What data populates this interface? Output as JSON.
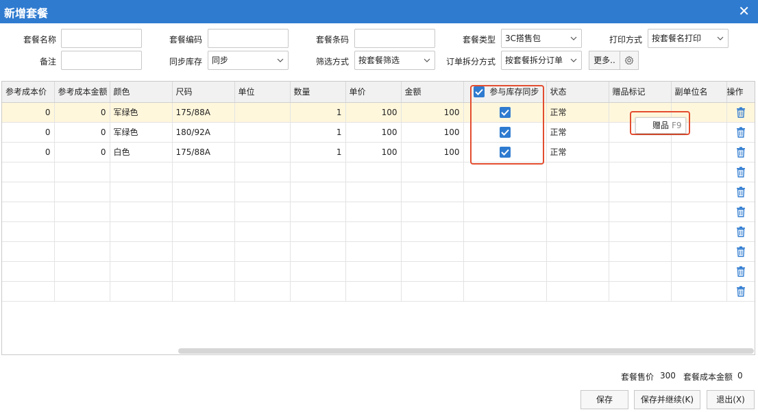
{
  "window": {
    "title": "新增套餐"
  },
  "form": {
    "name_label": "套餐名称",
    "code_label": "套餐编码",
    "barcode_label": "套餐条码",
    "type_label": "套餐类型",
    "type_value": "3C搭售包",
    "print_label": "打印方式",
    "print_value": "按套餐名打印",
    "remark_label": "备注",
    "sync_label": "同步库存",
    "sync_value": "同步",
    "filter_label": "筛选方式",
    "filter_value": "按套餐筛选",
    "split_label": "订单拆分方式",
    "split_value": "按套餐拆分订单",
    "more_label": "更多.."
  },
  "table": {
    "columns": [
      "参考成本价",
      "参考成本金额",
      "颜色",
      "尺码",
      "单位",
      "数量",
      "单价",
      "金额",
      "参与库存同步",
      "状态",
      "赠品标记",
      "副单位名",
      "操作"
    ],
    "rows": [
      {
        "cost": "0",
        "cost_amount": "0",
        "color": "军绿色",
        "size": "175/88A",
        "unit": "",
        "qty": "1",
        "price": "100",
        "amount": "100",
        "sync": true,
        "status": "正常"
      },
      {
        "cost": "0",
        "cost_amount": "0",
        "color": "军绿色",
        "size": "180/92A",
        "unit": "",
        "qty": "1",
        "price": "100",
        "amount": "100",
        "sync": true,
        "status": "正常"
      },
      {
        "cost": "0",
        "cost_amount": "0",
        "color": "白色",
        "size": "175/88A",
        "unit": "",
        "qty": "1",
        "price": "100",
        "amount": "100",
        "sync": true,
        "status": "正常"
      }
    ]
  },
  "popup": {
    "label": "赠品",
    "shortcut": "F9"
  },
  "summary": {
    "price_label": "套餐售价",
    "price_value": "300",
    "cost_label": "套餐成本金额",
    "cost_value": "0"
  },
  "buttons": {
    "save": "保存",
    "save_continue": "保存并继续(K)",
    "exit": "退出(X)"
  },
  "colors": {
    "titlebar": "#2f7bd0",
    "accent": "#2f7bd0",
    "highlight": "#e34c2e",
    "selected_row": "#fff7dc"
  }
}
